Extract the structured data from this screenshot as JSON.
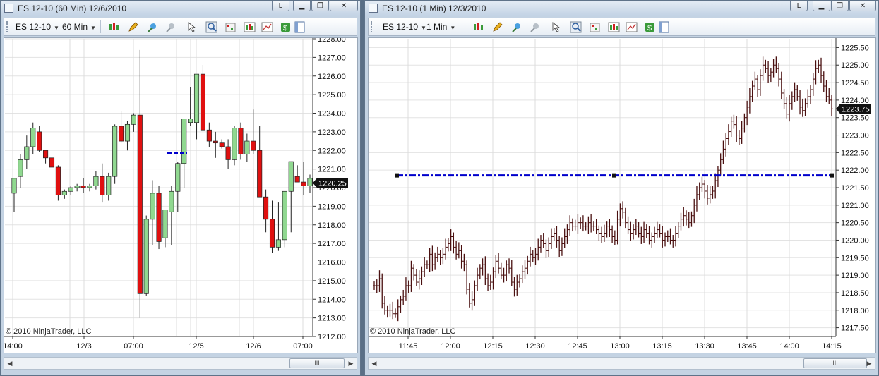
{
  "colors": {
    "up": "#90d890",
    "down": "#e01010",
    "line": "#0000cc",
    "bar": "#4a1010"
  },
  "left": {
    "title": "ES 12-10 (60 Min)  12/6/2010",
    "instrument": "ES 12-10",
    "interval": "60 Min",
    "controls": {
      "l": "L",
      "min": "▁",
      "max": "❐",
      "close": "✕"
    },
    "copyright": "© 2010 NinjaTrader, LLC",
    "price_label": "1220.25",
    "y_ticks": [
      "1228.00",
      "1227.00",
      "1226.00",
      "1225.00",
      "1224.00",
      "1223.00",
      "1222.00",
      "1221.00",
      "1220.00",
      "1219.00",
      "1218.00",
      "1217.00",
      "1216.00",
      "1215.00",
      "1214.00",
      "1213.00",
      "1212.00"
    ],
    "x_ticks": [
      "14:00",
      "12/3",
      "07:00",
      "12/5",
      "12/6",
      "07:00"
    ],
    "scroll_thumb": "III",
    "icons": [
      "candlestick-icon",
      "pencil-icon",
      "zoom-in-icon",
      "zoom-out-icon",
      "pointer-icon",
      "magnifier-icon",
      "strategy-icon",
      "bars-icon",
      "chart-icon",
      "dollar-icon",
      "properties-icon"
    ]
  },
  "right": {
    "title": "ES 12-10 (1 Min)  12/3/2010",
    "instrument": "ES 12-10",
    "interval": "1 Min",
    "controls": {
      "l": "L",
      "min": "▁",
      "max": "❐",
      "close": "✕"
    },
    "copyright": "© 2010 NinjaTrader, LLC",
    "price_label": "1223.75",
    "y_ticks": [
      "1225.50",
      "1225.00",
      "1224.50",
      "1224.00",
      "1223.50",
      "1223.00",
      "1222.50",
      "1222.00",
      "1221.50",
      "1221.00",
      "1220.50",
      "1220.00",
      "1219.50",
      "1219.00",
      "1218.50",
      "1218.00",
      "1217.50"
    ],
    "x_ticks": [
      "11:45",
      "12:00",
      "12:15",
      "12:30",
      "12:45",
      "13:00",
      "13:15",
      "13:30",
      "13:45",
      "14:00",
      "14:15"
    ],
    "scroll_thumb": "III",
    "icons": [
      "candlestick-icon",
      "pencil-icon",
      "zoom-in-icon",
      "zoom-out-icon",
      "pointer-icon",
      "magnifier-icon",
      "strategy-icon",
      "bars-icon",
      "chart-icon",
      "dollar-icon",
      "properties-icon"
    ]
  },
  "chart_data": [
    {
      "type": "candlestick",
      "instrument": "ES 12-10",
      "interval": "60 Min",
      "ylim": [
        1212,
        1228
      ],
      "y_tick_step": 1,
      "x_ticks": [
        "14:00",
        "12/3",
        "07:00",
        "12/5",
        "12/6",
        "07:00"
      ],
      "ohlc": [
        [
          1219.7,
          1220.5,
          1218.7,
          1220.5
        ],
        [
          1220.6,
          1221.8,
          1220.0,
          1221.5
        ],
        [
          1221.5,
          1222.8,
          1221.0,
          1222.2
        ],
        [
          1222.2,
          1223.5,
          1221.8,
          1223.2
        ],
        [
          1223.0,
          1223.3,
          1221.9,
          1222.0
        ],
        [
          1222.0,
          1222.0,
          1221.3,
          1221.6
        ],
        [
          1221.6,
          1221.8,
          1220.8,
          1221.1
        ],
        [
          1221.1,
          1221.2,
          1219.3,
          1219.6
        ],
        [
          1219.6,
          1219.9,
          1219.4,
          1219.8
        ],
        [
          1219.8,
          1220.1,
          1219.6,
          1220.0
        ],
        [
          1220.0,
          1220.2,
          1219.8,
          1220.1
        ],
        [
          1220.1,
          1220.5,
          1219.7,
          1220.0
        ],
        [
          1220.0,
          1220.2,
          1219.8,
          1220.1
        ],
        [
          1220.1,
          1220.9,
          1219.9,
          1220.6
        ],
        [
          1220.6,
          1221.3,
          1219.2,
          1219.6
        ],
        [
          1219.6,
          1220.8,
          1219.3,
          1220.6
        ],
        [
          1220.6,
          1223.4,
          1220.2,
          1223.3
        ],
        [
          1223.3,
          1224.1,
          1222.4,
          1222.5
        ],
        [
          1222.5,
          1223.6,
          1222.0,
          1223.4
        ],
        [
          1223.4,
          1224.0,
          1223.0,
          1223.9
        ],
        [
          1223.9,
          1227.4,
          1213.0,
          1214.3
        ],
        [
          1214.3,
          1218.5,
          1214.2,
          1218.3
        ],
        [
          1218.3,
          1220.4,
          1216.9,
          1219.7
        ],
        [
          1219.7,
          1220.1,
          1216.7,
          1217.1
        ],
        [
          1217.3,
          1218.7,
          1216.8,
          1218.8
        ],
        [
          1218.7,
          1220.1,
          1216.9,
          1219.8
        ],
        [
          1219.8,
          1221.4,
          1218.7,
          1221.3
        ],
        [
          1221.3,
          1222.8,
          1220.0,
          1223.7
        ],
        [
          1223.5,
          1225.4,
          1223.3,
          1223.7
        ],
        [
          1223.5,
          1225.8,
          1222.6,
          1226.1
        ],
        [
          1226.1,
          1226.6,
          1223.4,
          1223.1
        ],
        [
          1223.1,
          1223.5,
          1222.2,
          1222.5
        ],
        [
          1222.5,
          1223.0,
          1221.6,
          1222.4
        ],
        [
          1222.4,
          1222.6,
          1222.1,
          1222.2
        ],
        [
          1222.2,
          1222.6,
          1221.0,
          1221.5
        ],
        [
          1221.5,
          1223.3,
          1221.2,
          1223.2
        ],
        [
          1223.2,
          1223.5,
          1221.5,
          1221.8
        ],
        [
          1221.8,
          1222.9,
          1221.4,
          1222.5
        ],
        [
          1222.5,
          1224.2,
          1221.8,
          1222.0
        ],
        [
          1222.0,
          1223.3,
          1219.6,
          1219.5
        ],
        [
          1219.5,
          1219.9,
          1217.6,
          1218.3
        ],
        [
          1218.3,
          1219.3,
          1216.5,
          1216.8
        ],
        [
          1216.8,
          1219.2,
          1216.6,
          1217.2
        ],
        [
          1217.2,
          1219.6,
          1216.8,
          1219.8
        ],
        [
          1219.8,
          1221.2,
          1217.6,
          1221.4
        ],
        [
          1220.6,
          1221.2,
          1220.3,
          1220.3
        ],
        [
          1220.3,
          1221.4,
          1219.6,
          1220.1
        ],
        [
          1220.1,
          1220.7,
          1219.7,
          1220.5
        ]
      ],
      "horizontal_line": {
        "price": 1221.85,
        "style": "dash"
      },
      "last_price": 1220.25
    },
    {
      "type": "ohlc-bar",
      "instrument": "ES 12-10",
      "interval": "1 Min",
      "ylim": [
        1217.25,
        1225.75
      ],
      "y_tick_step": 0.5,
      "x_ticks": [
        "11:45",
        "12:00",
        "12:15",
        "12:30",
        "12:45",
        "13:00",
        "13:15",
        "13:30",
        "13:45",
        "14:00",
        "14:15"
      ],
      "start_time": "11:34",
      "closes": [
        1218.7,
        1218.7,
        1218.9,
        1218.2,
        1218.0,
        1218.0,
        1218.0,
        1217.9,
        1217.9,
        1218.1,
        1218.3,
        1218.4,
        1218.7,
        1218.7,
        1219.2,
        1219.0,
        1218.8,
        1218.9,
        1219.1,
        1219.3,
        1219.3,
        1219.6,
        1219.3,
        1219.5,
        1219.6,
        1219.5,
        1219.6,
        1219.8,
        1219.9,
        1220.1,
        1219.8,
        1219.6,
        1219.7,
        1219.4,
        1219.3,
        1218.6,
        1218.2,
        1218.3,
        1218.7,
        1219.0,
        1219.2,
        1219.3,
        1218.9,
        1218.7,
        1218.8,
        1219.1,
        1219.4,
        1219.2,
        1219.0,
        1219.0,
        1219.3,
        1219.2,
        1218.8,
        1218.6,
        1218.8,
        1218.9,
        1219.1,
        1219.2,
        1219.4,
        1219.6,
        1219.5,
        1219.6,
        1219.8,
        1220.0,
        1219.9,
        1219.7,
        1219.9,
        1220.1,
        1220.2,
        1220.0,
        1219.7,
        1219.9,
        1220.1,
        1220.3,
        1220.5,
        1220.4,
        1220.4,
        1220.5,
        1220.5,
        1220.4,
        1220.4,
        1220.5,
        1220.4,
        1220.4,
        1220.3,
        1220.2,
        1220.1,
        1220.2,
        1220.4,
        1220.3,
        1220.1,
        1220.0,
        1220.6,
        1220.9,
        1220.8,
        1220.5,
        1220.3,
        1220.2,
        1220.3,
        1220.4,
        1220.2,
        1220.1,
        1220.3,
        1220.2,
        1220.0,
        1220.1,
        1220.2,
        1220.3,
        1220.2,
        1220.0,
        1220.1,
        1220.1,
        1220.0,
        1220.0,
        1220.2,
        1220.4,
        1220.6,
        1220.7,
        1220.6,
        1220.5,
        1220.7,
        1221.0,
        1221.3,
        1221.5,
        1221.6,
        1221.4,
        1221.2,
        1221.3,
        1221.4,
        1221.7,
        1222.0,
        1222.3,
        1222.6,
        1222.9,
        1223.1,
        1223.4,
        1223.3,
        1223.0,
        1222.9,
        1223.2,
        1223.5,
        1223.8,
        1224.1,
        1224.4,
        1224.6,
        1224.3,
        1224.7,
        1225.0,
        1224.9,
        1224.7,
        1224.8,
        1225.0,
        1224.9,
        1224.6,
        1224.2,
        1223.9,
        1223.6,
        1223.9,
        1224.1,
        1224.3,
        1224.1,
        1223.8,
        1223.7,
        1223.9,
        1224.1,
        1224.3,
        1224.6,
        1224.9,
        1225.0,
        1224.7,
        1224.4,
        1224.1,
        1224.0,
        1223.75
      ],
      "horizontal_line": {
        "price": 1221.85,
        "style": "dash-dot"
      },
      "last_price": 1223.75
    }
  ]
}
